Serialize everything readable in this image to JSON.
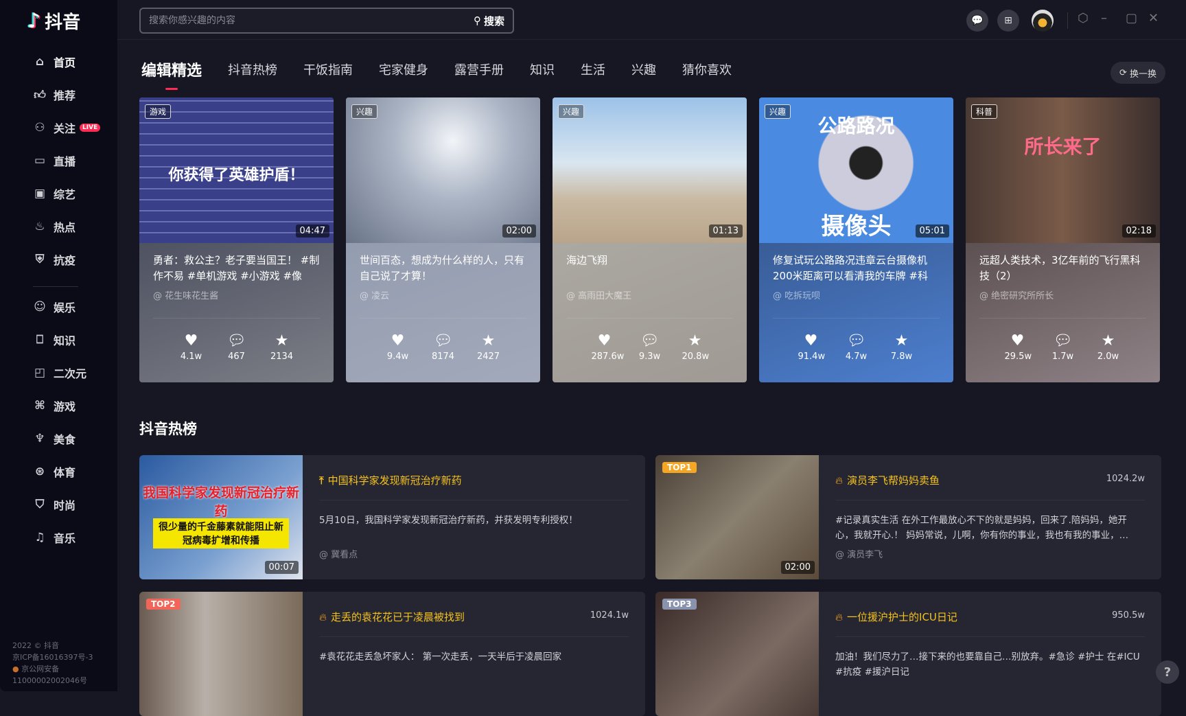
{
  "app": {
    "name": "抖音"
  },
  "search": {
    "placeholder": "搜索你感兴趣的内容",
    "button": "搜索"
  },
  "sidebar": {
    "items": [
      {
        "label": "首页",
        "icon": "home-icon"
      },
      {
        "label": "推荐",
        "icon": "thumbs-up-icon"
      },
      {
        "label": "关注",
        "icon": "user-icon",
        "badge": "LIVE"
      },
      {
        "label": "直播",
        "icon": "live-tv-icon"
      },
      {
        "label": "综艺",
        "icon": "tv-icon"
      },
      {
        "label": "热点",
        "icon": "flame-icon"
      },
      {
        "label": "抗疫",
        "icon": "shield-icon"
      },
      {
        "label": "娱乐",
        "icon": "smile-icon"
      },
      {
        "label": "知识",
        "icon": "bookmark-icon"
      },
      {
        "label": "二次元",
        "icon": "anime-icon"
      },
      {
        "label": "游戏",
        "icon": "gamepad-icon"
      },
      {
        "label": "美食",
        "icon": "food-icon"
      },
      {
        "label": "体育",
        "icon": "ball-icon"
      },
      {
        "label": "时尚",
        "icon": "shirt-icon"
      },
      {
        "label": "音乐",
        "icon": "music-icon"
      }
    ],
    "footer": {
      "copyright": "2022 © 抖音",
      "icp": "京ICP备16016397号-3",
      "police": "京公网安备",
      "police_no": "11000002002046号"
    }
  },
  "tabs": [
    "编辑精选",
    "抖音热榜",
    "干饭指南",
    "宅家健身",
    "露营手册",
    "知识",
    "生活",
    "兴趣",
    "猜你喜欢"
  ],
  "refresh_label": "换一换",
  "cards": [
    {
      "tag": "游戏",
      "duration": "04:47",
      "overlay": "你获得了英雄护盾！",
      "title": "勇者：救公主？老子要当国王！ #制作不易 #单机游戏 #小游戏 #像素…",
      "author": "@ 花生味花生酱",
      "likes": "4.1w",
      "comments": "467",
      "favorites": "2134"
    },
    {
      "tag": "兴趣",
      "duration": "02:00",
      "title": "世间百态，想成为什么样的人，只有自己说了才算！",
      "author": "@ 凌云",
      "likes": "9.4w",
      "comments": "8174",
      "favorites": "2427"
    },
    {
      "tag": "兴趣",
      "duration": "01:13",
      "title": "海边飞翔",
      "author": "@ 高雨田大魔王",
      "likes": "287.6w",
      "comments": "9.3w",
      "favorites": "20.8w"
    },
    {
      "tag": "兴趣",
      "duration": "05:01",
      "overlay": "公路路况",
      "overlay2": "摄像头",
      "title": "修复试玩公路路况违章云台摄像机 200米距离可以看清我的车牌 #科技…",
      "author": "@ 吃拆玩呗",
      "likes": "91.4w",
      "comments": "4.7w",
      "favorites": "7.8w"
    },
    {
      "tag": "科普",
      "duration": "02:18",
      "overlay": "所长来了",
      "title": "远超人类技术，3亿年前的飞行黑科技（2）",
      "author": "@ 绝密研究所所长",
      "likes": "29.5w",
      "comments": "1.7w",
      "favorites": "2.0w"
    }
  ],
  "hot_section": {
    "title": "抖音热榜"
  },
  "hot": [
    {
      "badge": "",
      "icon": "pin-top-icon",
      "title": "中国科学家发现新冠治疗新药",
      "count": "",
      "overlay": "我国科学家发现新冠治疗新药",
      "overlay2": "很少量的千金藤素就能阻止新冠病毒扩增和传播",
      "duration": "00:07",
      "desc": "5月10日，我国科学家发现新冠治疗新药，并获发明专利授权！",
      "author": "@ 冀看点"
    },
    {
      "badge": "TOP1",
      "badge_color": "#f5a623",
      "icon": "flame-icon",
      "title": "演员李飞帮妈妈卖鱼",
      "count": "1024.2w",
      "duration": "02:00",
      "desc": "#记录真实生活 在外工作最放心不下的就是妈妈，回来了.陪妈妈，她开心，我就开心.！ 妈妈常说，儿啊，你有你的事业，我也有我的事业，…",
      "author": "@ 演员李飞"
    },
    {
      "badge": "TOP2",
      "badge_color": "#f2665a",
      "icon": "flame-icon",
      "title": "走丢的袁花花已于凌晨被找到",
      "count": "1024.1w",
      "desc": "#袁花花走丢急坏家人： 第一次走丢，一天半后于凌晨回家",
      "author": ""
    },
    {
      "badge": "TOP3",
      "badge_color": "#8a93ad",
      "icon": "flame-icon",
      "title": "一位援沪护士的ICU日记",
      "count": "950.5w",
      "desc": "加油！我们尽力了…接下来的也要靠自己…别放弃。#急诊 #护士 在#ICU #抗疫 #援沪日记",
      "author": ""
    }
  ],
  "colors": {
    "accent": "#fe2c55",
    "hot_title": "#f6c21c",
    "background": "#161722",
    "sidebar": "#0b0b17"
  }
}
